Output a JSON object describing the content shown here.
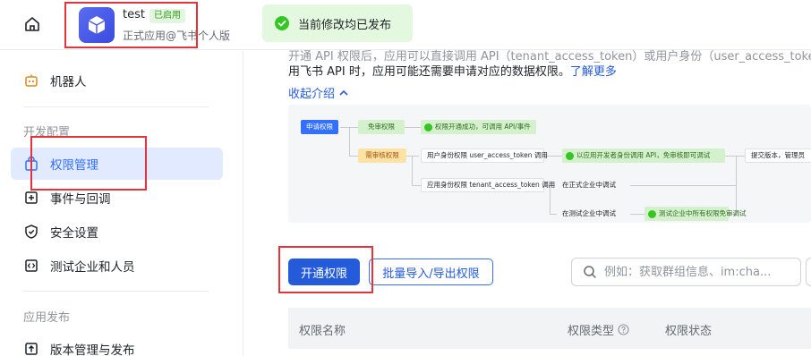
{
  "header": {
    "app_name": "test",
    "app_status": "已启用",
    "app_subtitle": "正式应用@飞书个人版",
    "toast": "当前修改均已发布"
  },
  "sidebar": {
    "items": [
      {
        "label": "机器人",
        "icon": "robot-icon"
      },
      {
        "label": "权限管理",
        "icon": "permission-icon",
        "active": true
      },
      {
        "label": "事件与回调",
        "icon": "event-icon"
      },
      {
        "label": "安全设置",
        "icon": "shield-icon"
      },
      {
        "label": "测试企业和人员",
        "icon": "code-icon"
      },
      {
        "label": "版本管理与发布",
        "icon": "upload-icon"
      }
    ],
    "groups": {
      "dev_config": "开发配置",
      "app_release": "应用发布"
    }
  },
  "main": {
    "intro_partial": "开通 API 权限后，应用可以直接调用 API（tenant_access_token）或用户身份（user_access_token）调",
    "intro_line": "用飞书 API 时，应用可能还需要申请对应的数据权限。",
    "learn_more": "了解更多",
    "collapse": "收起介绍",
    "flow": {
      "apply": "申请权限",
      "free_review": "免审权限",
      "free_result": "权限开通成功，可调用 API/事件",
      "need_review": "需审核权限",
      "user_identity": "用户身份权限 user_access_token 调用",
      "dev_identity": "以应用开发者身份调用 API，免审核即可调试",
      "submit": "提交版本，管理员",
      "app_identity": "应用身份权限 tenant_access_token 调用",
      "formal_debug": "在正式企业中调试",
      "test_debug": "在测试企业中调试",
      "test_result": "测试企业中所有权限免审调试"
    },
    "actions": {
      "enable": "开通权限",
      "batch": "批量导入/导出权限"
    },
    "search": {
      "placeholder": "例如：获取群组信息、im:cha..."
    },
    "table": {
      "columns": [
        "权限名称",
        "权限类型",
        "权限状态"
      ]
    }
  }
}
